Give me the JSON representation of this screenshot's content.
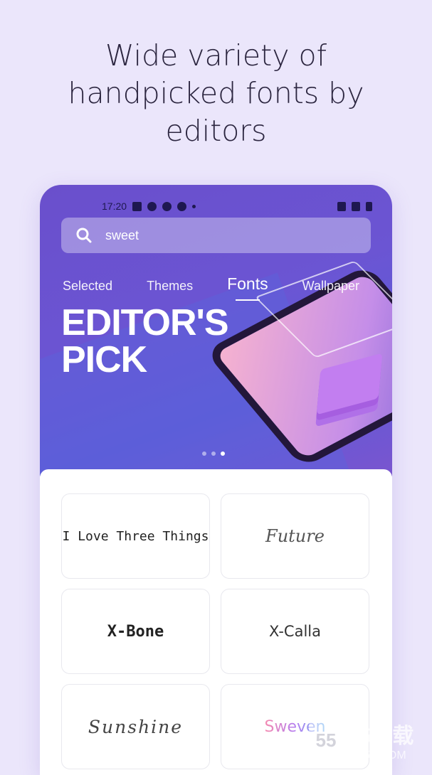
{
  "headline": "Wide variety of handpicked fonts by editors",
  "status": {
    "time": "17:20"
  },
  "search": {
    "value": "sweet",
    "icon": "search-icon"
  },
  "tabs": [
    {
      "label": "Selected"
    },
    {
      "label": "Themes"
    },
    {
      "label": "Fonts",
      "active": true
    },
    {
      "label": "Wallpaper"
    }
  ],
  "banner": {
    "line1": "EDITOR'S",
    "line2": "PICK",
    "page_dots": 3,
    "active_dot": 3
  },
  "fonts": [
    {
      "name": "I Love Three Things"
    },
    {
      "name": "Future"
    },
    {
      "name": "X-Bone"
    },
    {
      "name": "X-Calla"
    },
    {
      "name": "Sunshine"
    },
    {
      "name": "Sweven"
    }
  ],
  "watermark": {
    "logo": "55",
    "text": "55下载",
    "url": "RR55.COM"
  },
  "colors": {
    "background": "#ebe6fb",
    "banner": "#6a4fcc",
    "headline": "#2c2640"
  }
}
